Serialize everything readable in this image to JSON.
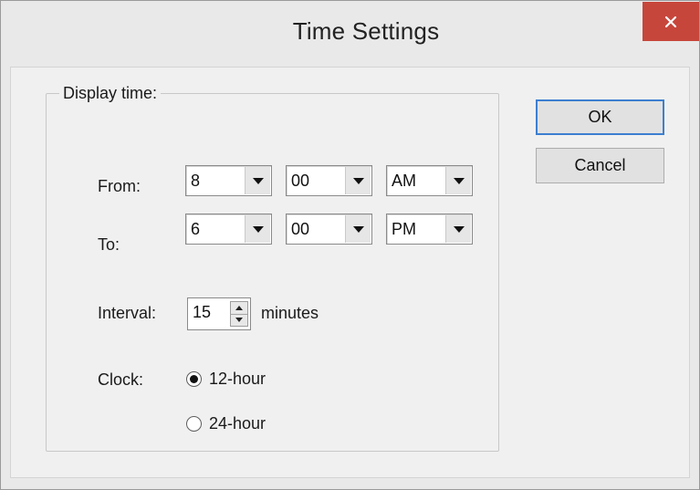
{
  "window": {
    "title": "Time Settings",
    "close_icon": "close-icon"
  },
  "display_time": {
    "group_label": "Display time:",
    "from": {
      "label": "From:",
      "hour": "8",
      "minute": "00",
      "ampm": "AM"
    },
    "to": {
      "label": "To:",
      "hour": "6",
      "minute": "00",
      "ampm": "PM"
    }
  },
  "interval": {
    "label": "Interval:",
    "value": "15",
    "unit": "minutes"
  },
  "clock": {
    "label": "Clock:",
    "options": [
      {
        "label": "12-hour",
        "selected": true
      },
      {
        "label": "24-hour",
        "selected": false
      }
    ]
  },
  "buttons": {
    "ok": "OK",
    "cancel": "Cancel"
  },
  "colors": {
    "close_bg": "#c7463b",
    "default_button_border": "#3c7fd0"
  }
}
